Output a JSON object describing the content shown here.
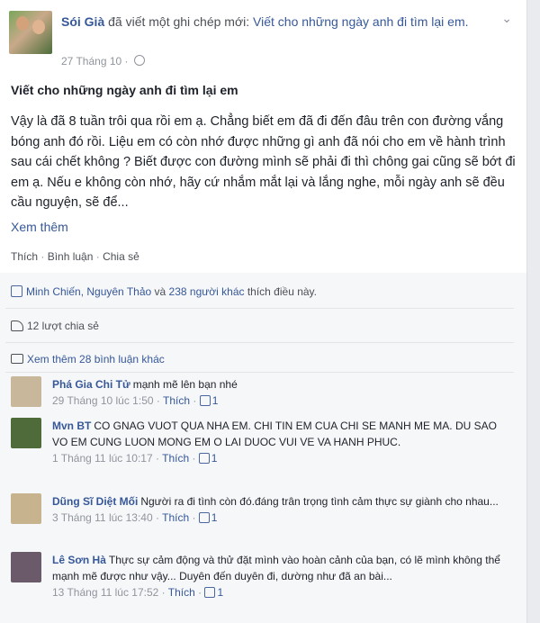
{
  "post": {
    "author": "Sói Già",
    "action_text": " đã viết một ghi chép mới: ",
    "note_link": "Viết cho những ngày anh đi tìm lại em.",
    "timestamp": "27 Tháng 10 · ",
    "title": "Viết cho những ngày anh đi tìm lại em",
    "body": "Vậy là đã 8 tuần trôi qua rồi em ạ. Chẳng biết em đã đi đến đâu trên con đường vắng bóng anh đó rồi. Liệu em có còn nhớ được những gì anh đã nói cho em về hành trình sau cái chết không ? Biết được con đường mình sẽ phải đi thì chông gai cũng sẽ bớt đi em ạ. Nếu e không còn nhớ, hãy cứ nhắm mắt lại và lắng nghe, mỗi ngày anh sẽ đều cầu nguyện, sẽ để...",
    "see_more": "Xem thêm",
    "actions": {
      "like": "Thích",
      "sep": " · ",
      "comment": "Bình luận",
      "share": "Chia sẻ"
    }
  },
  "feedback": {
    "likes_names": "Minh Chiến, Nguyên Thảo",
    "likes_and": " và ",
    "likes_others": "238 người khác",
    "likes_suffix": " thích điều này.",
    "shares": "12 lượt chia sẻ",
    "more_comments": "Xem thêm 28 bình luận khác"
  },
  "comments": [
    {
      "name": "Phá Gia Chi Tử",
      "text": "mạnh mẽ lên bạn nhé",
      "time": "29 Tháng 10 lúc 1:50",
      "like_label": "Thích",
      "likes": "1",
      "avatar_color": "#c8b79a"
    },
    {
      "name": "Mvn BT",
      "text": "CO GNAG VUOT QUA NHA EM. CHI TIN EM CUA CHI SE MANH ME MA. DU SAO VO EM CUNG LUON MONG EM O LAI DUOC VUI VE VA HANH PHUC.",
      "time": "1 Tháng 11 lúc 10:17",
      "like_label": "Thích",
      "likes": "1",
      "avatar_color": "#4f6b3a"
    },
    {
      "name": "Dũng Sĩ Diệt Mối",
      "text": "Người ra đi tình còn đó.đáng trân trọng tình cảm thực sự giành cho nhau...",
      "time": "3 Tháng 11 lúc 13:40",
      "like_label": "Thích",
      "likes": "1",
      "avatar_color": "#c7b48f"
    },
    {
      "name": "Lê Sơn Hà",
      "text": "Thực sự cảm động và thử đặt mình vào hoàn cảnh của bạn, có lẽ mình không thể mạnh mẽ được như vậy... Duyên đến duyên đi, dường như đã an bài...",
      "time": "13 Tháng 11 lúc 17:52",
      "like_label": "Thích",
      "likes": "1",
      "avatar_color": "#6b5a6a"
    }
  ],
  "icons": {
    "dropdown": "chevron-down-icon",
    "privacy": "globe-icon",
    "like": "thumbs-up-icon",
    "share": "share-icon",
    "comments": "comment-icon"
  }
}
